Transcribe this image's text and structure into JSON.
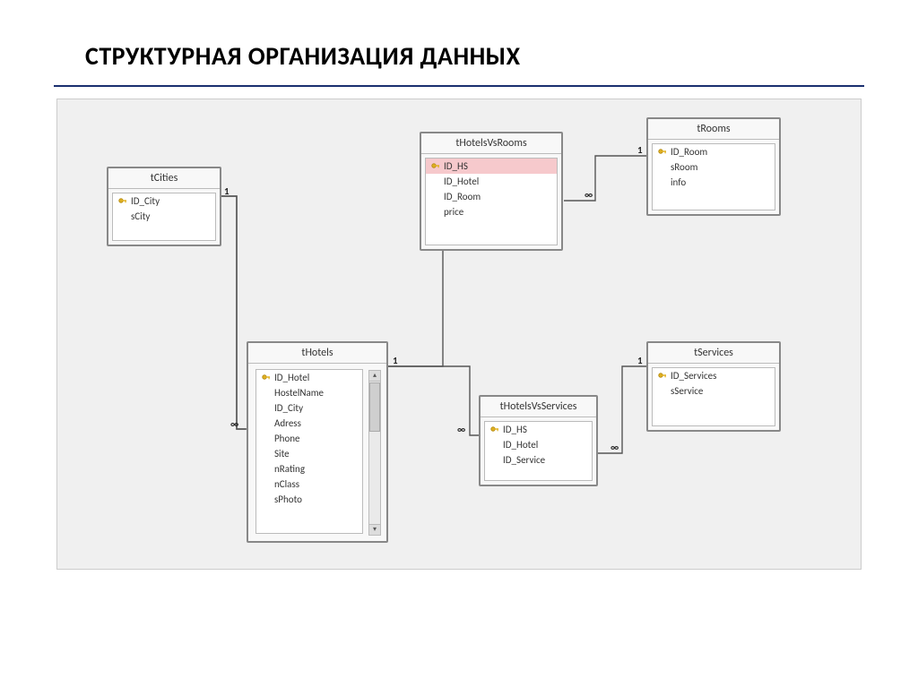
{
  "title": "СТРУКТУРНАЯ ОРГАНИЗАЦИЯ ДАННЫХ",
  "infinity": "∞",
  "tables": {
    "tCities": {
      "name": "tCities",
      "fields": [
        {
          "key": true,
          "name": "ID_City"
        },
        {
          "key": false,
          "name": "sCity"
        }
      ]
    },
    "tHotels": {
      "name": "tHotels",
      "fields": [
        {
          "key": true,
          "name": "ID_Hotel"
        },
        {
          "key": false,
          "name": "HostelName"
        },
        {
          "key": false,
          "name": "ID_City"
        },
        {
          "key": false,
          "name": "Adress"
        },
        {
          "key": false,
          "name": "Phone"
        },
        {
          "key": false,
          "name": "Site"
        },
        {
          "key": false,
          "name": "nRating"
        },
        {
          "key": false,
          "name": "nClass"
        },
        {
          "key": false,
          "name": "sPhoto"
        }
      ]
    },
    "tHotelsVsRooms": {
      "name": "tHotelsVsRooms",
      "fields": [
        {
          "key": true,
          "name": "ID_HS",
          "selected": true
        },
        {
          "key": false,
          "name": "ID_Hotel"
        },
        {
          "key": false,
          "name": "ID_Room"
        },
        {
          "key": false,
          "name": "price"
        }
      ]
    },
    "tRooms": {
      "name": "tRooms",
      "fields": [
        {
          "key": true,
          "name": "ID_Room"
        },
        {
          "key": false,
          "name": "sRoom"
        },
        {
          "key": false,
          "name": "info"
        }
      ]
    },
    "tHotelsVsServices": {
      "name": "tHotelsVsServices",
      "fields": [
        {
          "key": true,
          "name": "ID_HS"
        },
        {
          "key": false,
          "name": "ID_Hotel"
        },
        {
          "key": false,
          "name": "ID_Service"
        }
      ]
    },
    "tServices": {
      "name": "tServices",
      "fields": [
        {
          "key": true,
          "name": "ID_Services"
        },
        {
          "key": false,
          "name": "sService"
        }
      ]
    }
  },
  "relations": [
    {
      "from": "tCities.ID_City",
      "to": "tHotels.ID_City",
      "fromCard": "1",
      "toCard": "∞"
    },
    {
      "from": "tHotels.ID_Hotel",
      "to": "tHotelsVsRooms.ID_Hotel",
      "fromCard": "1",
      "toCard": "∞"
    },
    {
      "from": "tRooms.ID_Room",
      "to": "tHotelsVsRooms.ID_Room",
      "fromCard": "1",
      "toCard": "∞"
    },
    {
      "from": "tHotels.ID_Hotel",
      "to": "tHotelsVsServices.ID_Hotel",
      "fromCard": "1",
      "toCard": "∞"
    },
    {
      "from": "tServices.ID_Services",
      "to": "tHotelsVsServices.ID_Service",
      "fromCard": "1",
      "toCard": "∞"
    }
  ]
}
